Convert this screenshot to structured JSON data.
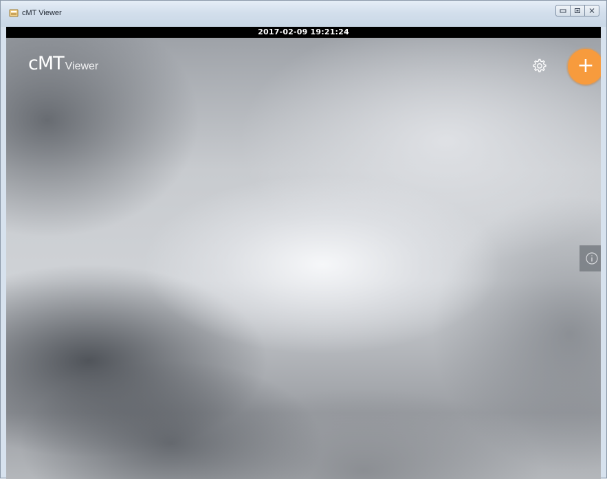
{
  "window": {
    "title": "cMT Viewer",
    "icon": "app-icon",
    "controls": [
      "minimize-icon",
      "maximize-icon",
      "close-icon"
    ]
  },
  "statusbar": {
    "datetime": "2017-02-09 19:21:24"
  },
  "header": {
    "logo_main": "cMT",
    "logo_sub": "Viewer",
    "settings_icon": "gear-icon",
    "add_label": "+",
    "add_color": "#f79b3d"
  },
  "sidebar": {
    "info_icon": "info-icon"
  }
}
